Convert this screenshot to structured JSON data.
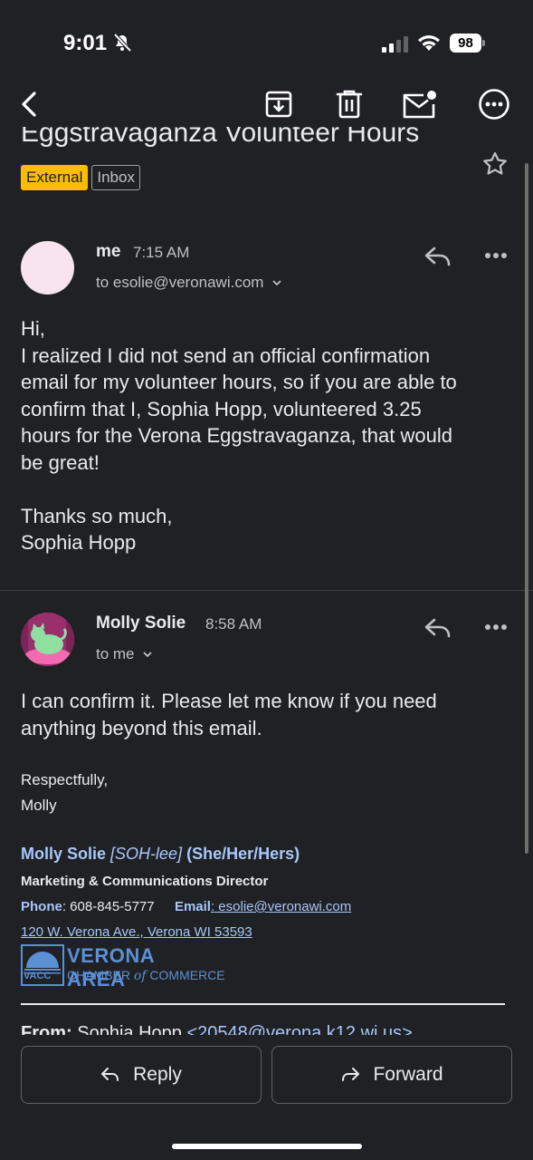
{
  "status_bar": {
    "time": "9:01",
    "battery": "98"
  },
  "toolbar": {
    "back_icon": "chevron-left-icon",
    "archive_icon": "archive-icon",
    "delete_icon": "trash-icon",
    "unread_icon": "mail-unread-icon",
    "more_icon": "more-horizontal-icon"
  },
  "email": {
    "subject": "Eggstravaganza Volunteer Hours",
    "labels": {
      "external": "External",
      "inbox": "Inbox"
    }
  },
  "messages": [
    {
      "sender": "me",
      "time": "7:15 AM",
      "to": "to esolie@veronawi.com",
      "body": [
        "Hi,",
        "I realized I did not send an official confirmation",
        "email for my volunteer hours, so if you are able to",
        "confirm that I, Sophia Hopp, volunteered 3.25",
        "hours for the Verona Eggstravaganza, that would",
        "be great!",
        "",
        "Thanks so much,",
        "Sophia Hopp"
      ]
    },
    {
      "sender": "Molly Solie",
      "time": "8:58 AM",
      "to": "to me",
      "body": [
        "I can confirm it. Please let me know if you need",
        "anything beyond this email."
      ],
      "closing": [
        "Respectfully,",
        "Molly"
      ],
      "signature": {
        "name": "Molly Solie",
        "pronunciation": "[SOH-lee]",
        "pronouns": "(She/Her/Hers)",
        "title": "Marketing & Communications Director",
        "phone_label": "Phone",
        "phone": ": 608-845-5777",
        "email_label": "Email",
        "email": " esolie@veronawi.com",
        "address_street": "120 W. Verona Ave.,",
        "address_city": "Verona WI 53593",
        "logo_name": "VERONA AREA",
        "logo_vacc": "VACC",
        "logo_sub_1": "CHAMBER",
        "logo_sub_of": "of",
        "logo_sub_2": "COMMERCE"
      },
      "quoted": {
        "from_label": "From:",
        "from_name": "Sophia Hopp",
        "from_email": "<20548@verona.k12.wi.us>"
      }
    }
  ],
  "actions": {
    "reply": "Reply",
    "forward": "Forward"
  }
}
